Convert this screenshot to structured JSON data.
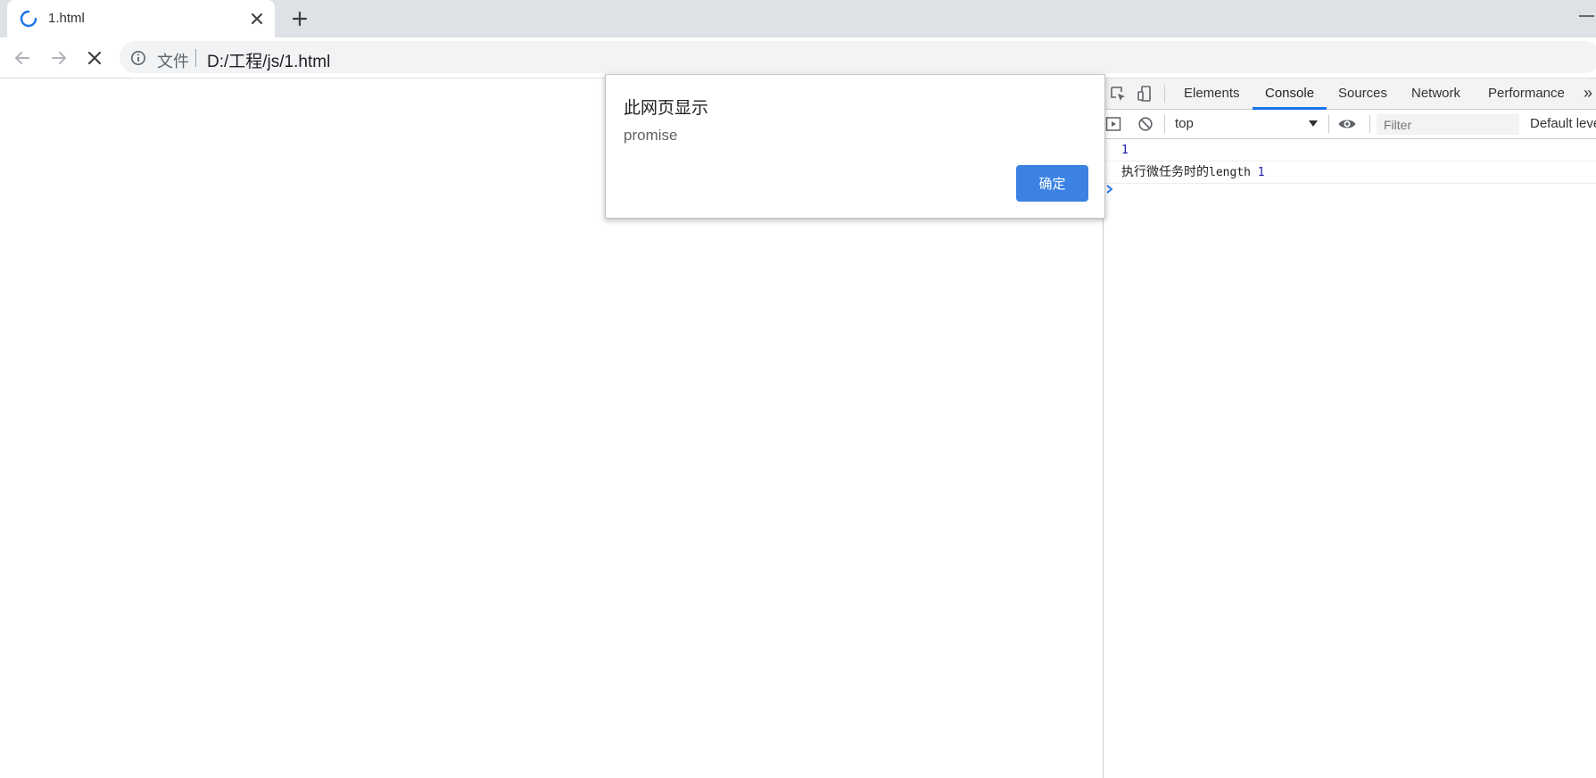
{
  "browser": {
    "tab": {
      "title": "1.html"
    },
    "omnibox": {
      "scheme_label": "文件",
      "url": "D:/工程/js/1.html"
    }
  },
  "devtools": {
    "tabs": [
      "Elements",
      "Console",
      "Sources",
      "Network",
      "Performance"
    ],
    "more_label": "»",
    "context": "top",
    "filter_placeholder": "Filter",
    "levels_label": "Default levels",
    "log": [
      {
        "value": "1"
      },
      {
        "text": "执行微任务时的",
        "mono": "length",
        "value": "1"
      }
    ]
  },
  "alert": {
    "title": "此网页显示",
    "message": "promise",
    "ok_label": "确定"
  },
  "colors": {
    "accent": "#1a73e8",
    "ok_button": "#3b82e3",
    "tabstrip": "#dee1e6"
  }
}
